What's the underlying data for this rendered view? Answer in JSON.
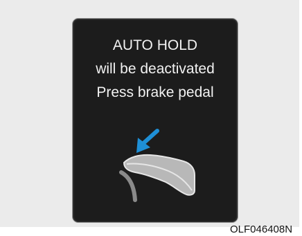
{
  "display": {
    "line1": "AUTO HOLD",
    "line2": "will be deactivated",
    "line3": "Press brake pedal"
  },
  "icons": {
    "arrow": "arrow-icon",
    "shoe": "shoe-icon",
    "pedal": "brake-pedal-icon"
  },
  "colors": {
    "arrow": "#1e8fd6",
    "panel": "#1c1c1c",
    "text": "#f2f2f2"
  },
  "caption": "OLF046408N"
}
